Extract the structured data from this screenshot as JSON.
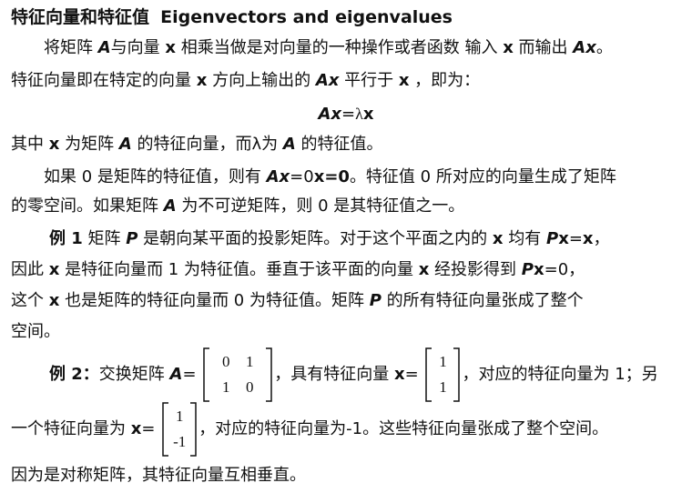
{
  "title": {
    "cn": "特征向量和特征值",
    "en": "Eigenvectors and eigenvalues"
  },
  "p1": {
    "a": "将矩阵 ",
    "A": "A",
    "b": "与向量 ",
    "x1": "x",
    "c": " 相乘当做是对向量的一种操作或者函数 输入 ",
    "x2": "x",
    "d": " 而输出 ",
    "Ax": "Ax",
    "e": "。",
    "l2a": "特征向量即在特定的向量 ",
    "l2x": "x",
    "l2b": " 方向上输出的 ",
    "l2Ax": "Ax",
    "l2c": " 平行于 ",
    "l2x2": "x",
    "l2d": " ，即为："
  },
  "equation": {
    "Ax": "Ax",
    "eq": "=",
    "lambda": "λ",
    "x": "x"
  },
  "p2": {
    "a": "其中 ",
    "x": "x",
    "b": " 为矩阵 ",
    "A": "A",
    "c": " 的特征向量，而λ为 ",
    "A2": "A",
    "d": " 的特征值。"
  },
  "p3": {
    "a": "如果 0 是矩阵的特征值，则有 ",
    "Ax": "Ax",
    "b": "=0",
    "x0": "x=0",
    "c": "。特征值 0 所对应的向量生成了矩阵",
    "l2a": "的零空间。如果矩阵 ",
    "A": "A",
    "l2b": " 为不可逆矩阵，则 0 是其特征值之一。"
  },
  "ex1": {
    "label": "例 1",
    "a": " 矩阵 ",
    "P": "P",
    "b": " 是朝向某平面的投影矩阵。对于这个平面之内的 ",
    "x": "x",
    "c": " 均有 ",
    "Px": "P",
    "xb": "x",
    "d": "=",
    "x3": "x",
    "e": "，",
    "l2a": "因此 ",
    "l2x": "x",
    "l2b": " 是特征向量而 1 为特征值。垂直于该平面的向量 ",
    "l2x2": "x",
    "l2c": " 经投影得到 ",
    "l2P": "P",
    "l2x3": "x",
    "l2d": "=0，",
    "l3a": "这个 ",
    "l3x": "x",
    "l3b": " 也是矩阵的特征向量而 0 为特征值。矩阵 ",
    "l3P": "P",
    "l3c": " 的所有特征向量张成了整个",
    "l4": "空间。"
  },
  "ex2": {
    "label": "例 2",
    "colon": "：",
    "a": "交换矩阵 ",
    "A": "A",
    "eq": "=",
    "matrix": [
      "0",
      "1",
      "1",
      "0"
    ],
    "b": "，具有特征向量 ",
    "x": "x",
    "eq2": "=",
    "vec1": [
      "1",
      "1"
    ],
    "c": "，对应的特征向量为 1；另",
    "l2a": "一个特征向量为  ",
    "l2x": "x",
    "l2eq": "=",
    "vec2": [
      "1",
      "-1"
    ],
    "l2b": "，对应的特征向量为-1。这些特征向量张成了整个空间。",
    "l3": "因为是对称矩阵，其特征向量互相垂直。"
  }
}
